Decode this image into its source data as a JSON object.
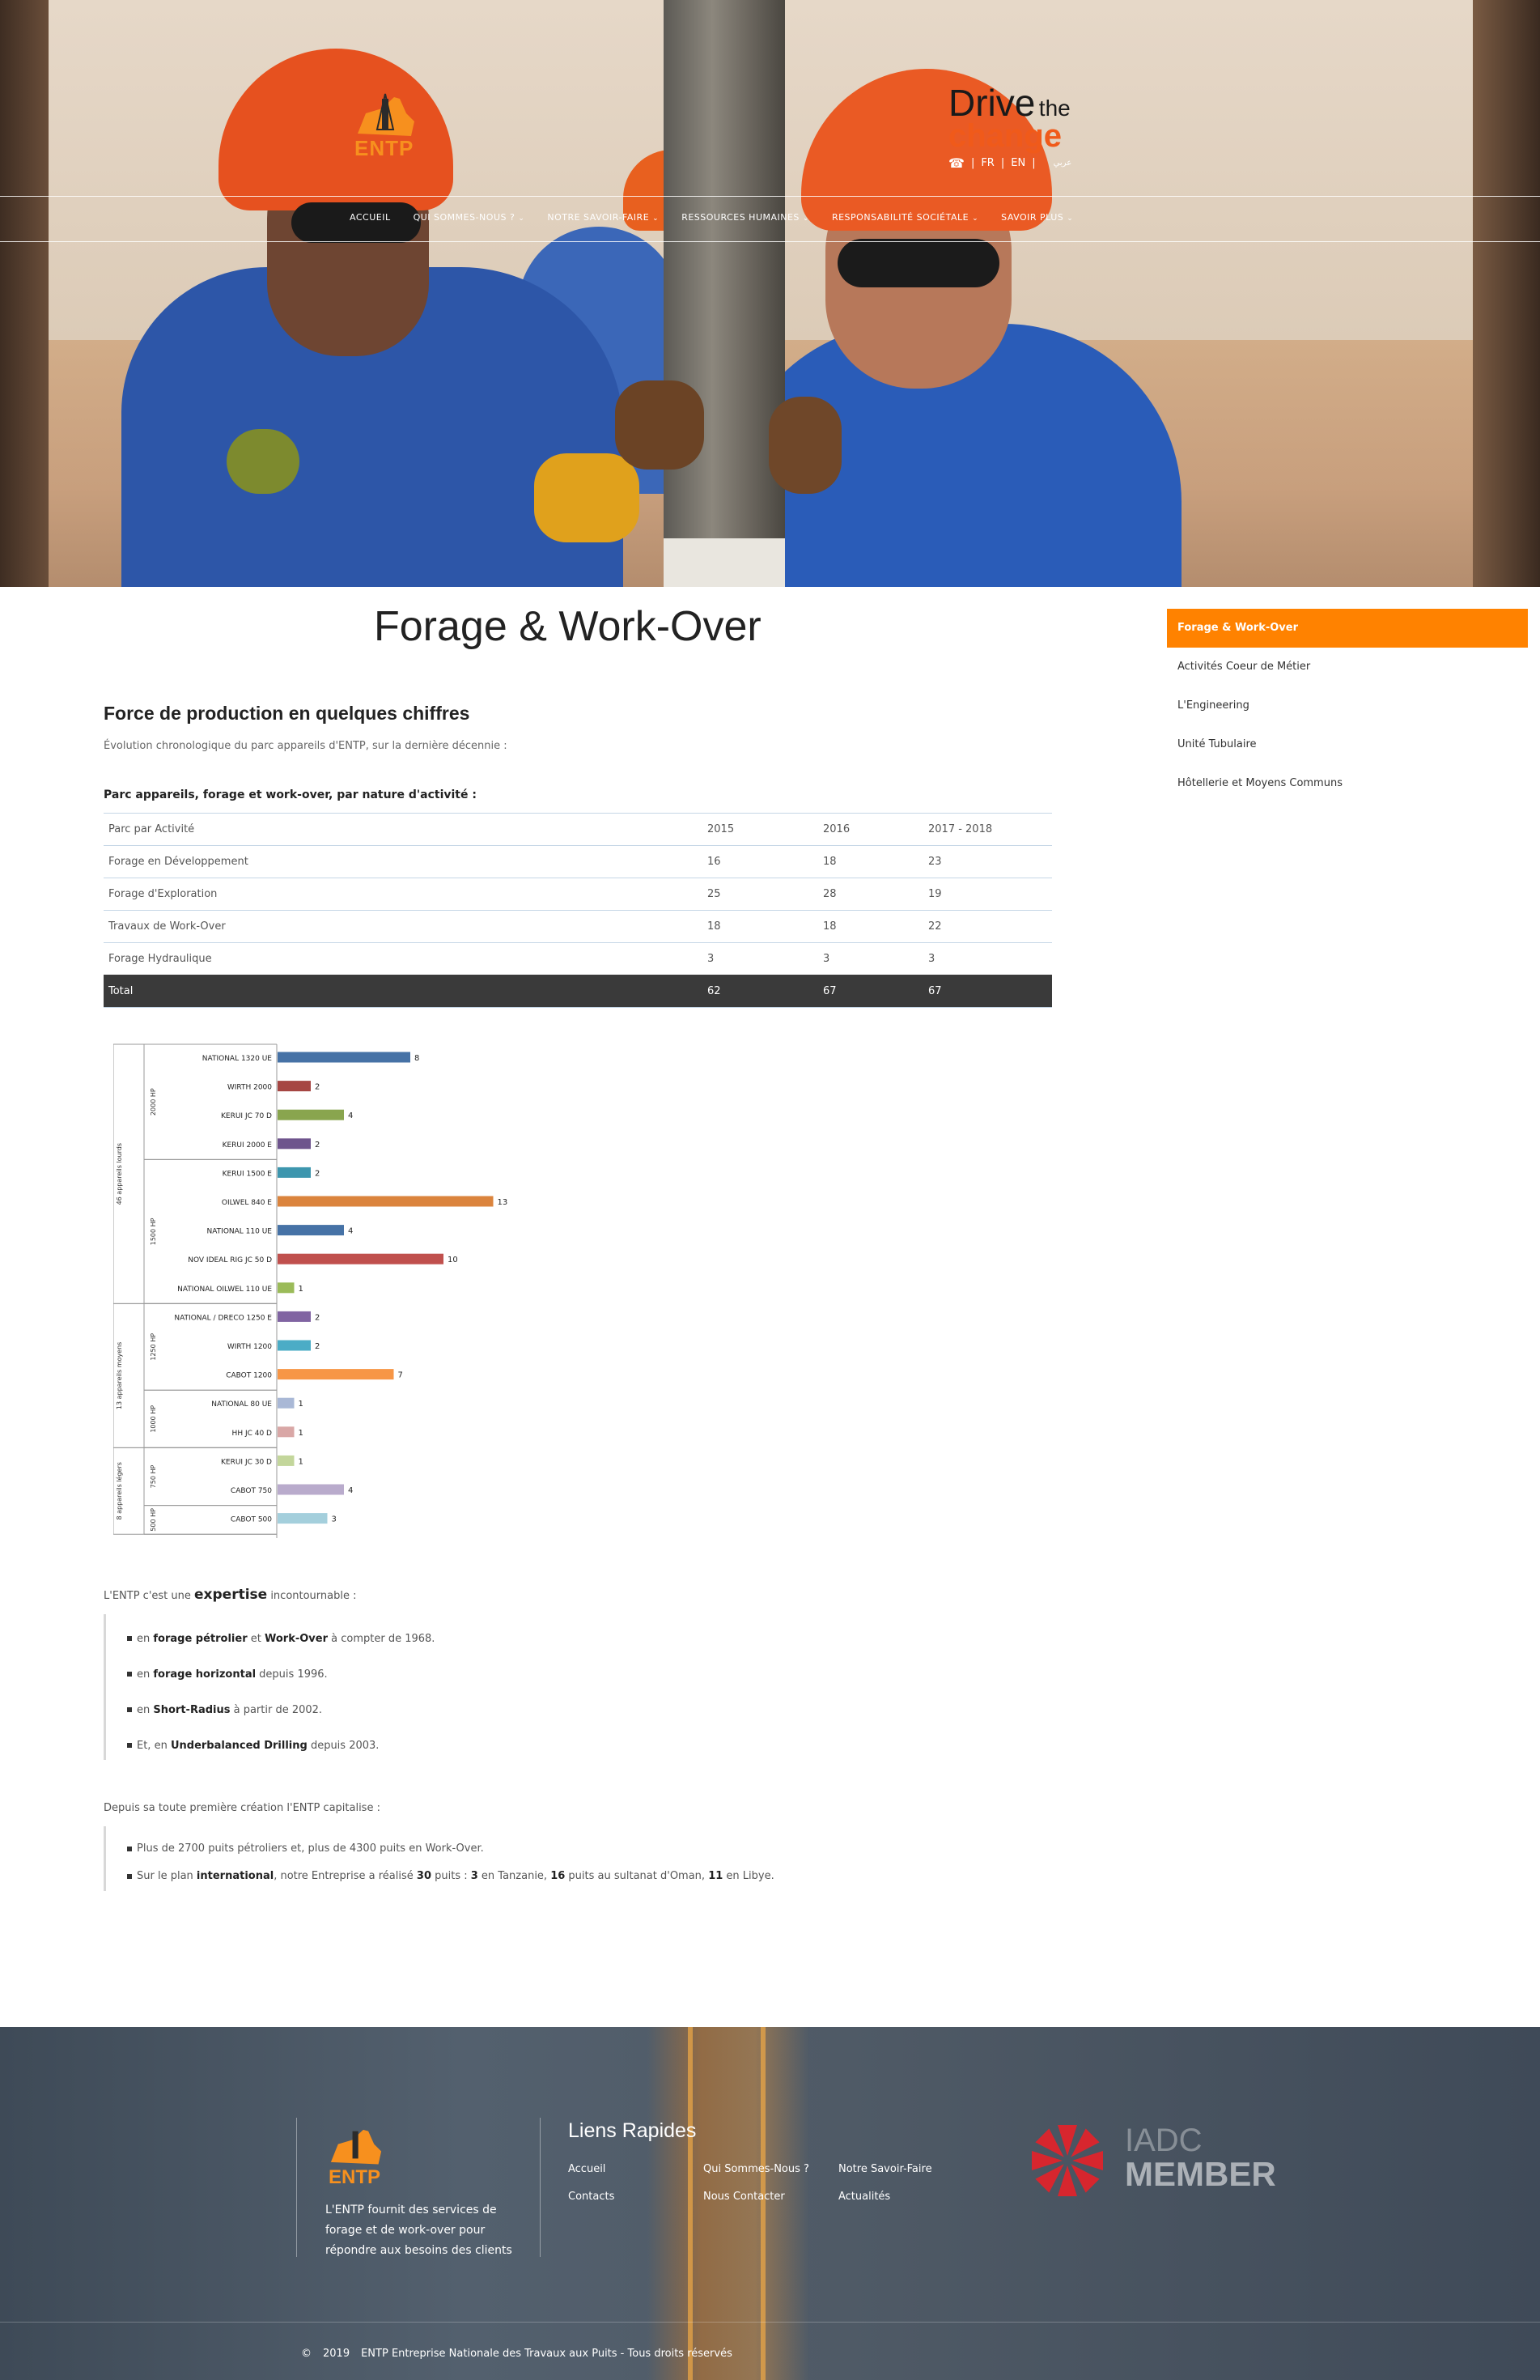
{
  "header": {
    "logo_text": "ENTP",
    "slogan_big": "Drive",
    "slogan_small": "the",
    "slogan_change": "change",
    "lang_sep": "|",
    "lang_fr": "FR",
    "lang_en": "EN",
    "lang_ar": "عربي",
    "nav": [
      {
        "label": "ACCUEIL",
        "caret": ""
      },
      {
        "label": "QUI SOMMES-NOUS ?",
        "caret": "⌄"
      },
      {
        "label": "NOTRE SAVOIR-FAIRE",
        "caret": "⌄"
      },
      {
        "label": "RESSOURCES HUMAINES",
        "caret": "⌄"
      },
      {
        "label": "RESPONSABILITÉ SOCIÉTALE",
        "caret": "⌄"
      },
      {
        "label": "SAVOIR PLUS",
        "caret": "⌄"
      }
    ]
  },
  "main": {
    "title": "Forage & Work-Over",
    "section_title": "Force de production en quelques chiffres",
    "intro": "Évolution chronologique du parc appareils d'ENTP, sur la dernière décennie :",
    "table_caption": "Parc appareils, forage et work-over, par nature d'activité :",
    "table": {
      "headers": [
        "Parc par Activité",
        "2015",
        "2016",
        "2017 - 2018"
      ],
      "rows": [
        [
          "Forage en Développement",
          "16",
          "18",
          "23"
        ],
        [
          "Forage d'Exploration",
          "25",
          "28",
          "19"
        ],
        [
          "Travaux de Work-Over",
          "18",
          "18",
          "22"
        ],
        [
          "Forage Hydraulique",
          "3",
          "3",
          "3"
        ]
      ],
      "total": [
        "Total",
        "62",
        "67",
        "67"
      ]
    },
    "expertise_prefix": "L'ENTP c'est une ",
    "expertise_kw": "expertise",
    "expertise_suffix": " incontournable :",
    "expertise_items": [
      {
        "a": "en ",
        "b1": "forage pétrolier",
        "c": " et ",
        "b2": "Work-Over",
        "d": " à compter de 1968."
      },
      {
        "a": "en ",
        "b1": "forage horizontal",
        "c": " depuis 1996.",
        "b2": "",
        "d": ""
      },
      {
        "a": "en ",
        "b1": "Short-Radius",
        "c": " à partir de 2002.",
        "b2": "",
        "d": ""
      },
      {
        "a": "Et, en ",
        "b1": "Underbalanced Drilling",
        "c": " depuis 2003.",
        "b2": "",
        "d": ""
      }
    ],
    "capitalise": "Depuis sa toute première création l'ENTP capitalise :",
    "capitalise_item1": "Plus de 2700 puits pétroliers et, plus de 4300 puits en Work-Over.",
    "capitalise_item2": {
      "p1": "Sur le plan ",
      "b1": "international",
      "p2": ", notre Entreprise a réalisé ",
      "b2": "30",
      "p3": " puits : ",
      "b3": "3",
      "p4": " en Tanzanie, ",
      "b4": "16",
      "p5": "  puits au sultanat d'Oman, ",
      "b5": "11",
      "p6": " en Libye."
    }
  },
  "sidebar": {
    "items": [
      {
        "label": "Forage & Work-Over",
        "active": true
      },
      {
        "label": "Activités Coeur de Métier",
        "active": false
      },
      {
        "label": "L'Engineering",
        "active": false
      },
      {
        "label": "Unité Tubulaire",
        "active": false
      },
      {
        "label": "Hôtellerie et Moyens Communs",
        "active": false
      }
    ]
  },
  "chart_data": {
    "type": "bar",
    "orientation": "horizontal",
    "categories": [
      "NATIONAL 1320 UE",
      "WIRTH 2000",
      "KERUI JC 70 D",
      "KERUI 2000 E",
      "KERUI 1500 E",
      "OILWEL 840 E",
      "NATIONAL 110 UE",
      "NOV IDEAL RIG JC 50 D",
      "NATIONAL OILWEL 110 UE",
      "NATIONAL / DRECO 1250 E",
      "WIRTH 1200",
      "CABOT 1200",
      "NATIONAL 80 UE",
      "HH JC 40 D",
      "KERUI JC 30 D",
      "CABOT 750",
      "CABOT 500"
    ],
    "values": [
      8,
      2,
      4,
      2,
      2,
      13,
      4,
      10,
      1,
      2,
      2,
      7,
      1,
      1,
      1,
      4,
      3
    ],
    "colors": [
      "#4672a6",
      "#a64643",
      "#89a54e",
      "#6e548d",
      "#3d96ae",
      "#db843d",
      "#4672a6",
      "#c0504d",
      "#9bbb59",
      "#8064a2",
      "#4bacc6",
      "#f79646",
      "#a9b8d6",
      "#d9a7a6",
      "#c3d69b",
      "#b9abcc",
      "#a4cfdc"
    ],
    "hp_groups": [
      {
        "label": "2000 HP",
        "start": 0,
        "end": 3
      },
      {
        "label": "1500 HP",
        "start": 4,
        "end": 8
      },
      {
        "label": "1250 HP",
        "start": 9,
        "end": 11
      },
      {
        "label": "1000 HP",
        "start": 12,
        "end": 13
      },
      {
        "label": "750 HP",
        "start": 14,
        "end": 15
      },
      {
        "label": "500 HP",
        "start": 16,
        "end": 16
      }
    ],
    "class_groups": [
      {
        "label": "46 appareils lourds",
        "start": 0,
        "end": 8
      },
      {
        "label": "13 appareils moyens",
        "start": 9,
        "end": 13
      },
      {
        "label": "8 appareils légers",
        "start": 14,
        "end": 16
      }
    ],
    "xlim": [
      0,
      13
    ]
  },
  "footer": {
    "logo_text": "ENTP",
    "description": "L'ENTP fournit des services de forage et de work-over pour répondre aux besoins des clients",
    "links_title": "Liens Rapides",
    "links": [
      "Accueil",
      "Qui Sommes-Nous ?",
      "Notre Savoir-Faire",
      "Contacts",
      "Nous Contacter",
      "Actualités"
    ],
    "iadc_top": "IADC",
    "iadc_bottom": "MEMBER",
    "copyright_symbol": "©",
    "copyright_year": "2019",
    "copyright_text": "ENTP Entreprise Nationale des Travaux aux Puits - Tous droits réservés"
  }
}
